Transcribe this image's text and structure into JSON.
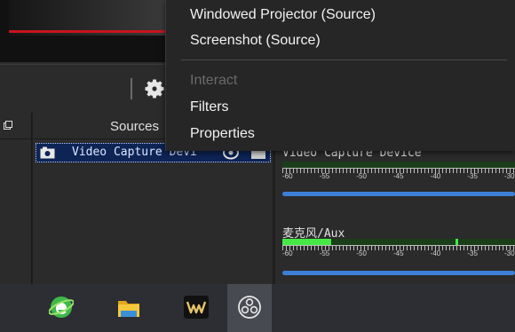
{
  "context_menu": {
    "items": [
      {
        "label": "Windowed Projector (Source)",
        "enabled": true
      },
      {
        "label": "Screenshot (Source)",
        "enabled": true
      },
      {
        "label": "Interact",
        "enabled": false
      },
      {
        "label": "Filters",
        "enabled": true
      },
      {
        "label": "Properties",
        "enabled": true
      }
    ]
  },
  "sources": {
    "header": "Sources",
    "items": [
      {
        "label": "Video Capture Devi",
        "icon": "camera-icon"
      }
    ]
  },
  "mixer": {
    "channels": [
      {
        "name": "Video Capture Device",
        "level": 0.0,
        "volume": 1.0,
        "scale": [
          "-60",
          "-55",
          "-50",
          "-45",
          "-40",
          "-35",
          "-30"
        ]
      },
      {
        "name": "麦克风/Aux",
        "level": 0.21,
        "volume": 1.0,
        "scale": [
          "-60",
          "-55",
          "-50",
          "-45",
          "-40",
          "-35",
          "-30"
        ]
      }
    ]
  },
  "taskbar": {
    "apps": [
      {
        "icon": "internet-explorer-icon",
        "active": false
      },
      {
        "icon": "file-explorer-icon",
        "active": false
      },
      {
        "icon": "wps-office-icon",
        "active": false
      },
      {
        "icon": "obs-studio-icon",
        "active": true
      }
    ]
  },
  "colors": {
    "menu_bg": "#262626",
    "selection": "#0d2455",
    "meter_green": "#46e846",
    "volume_blue": "#3d7fd6",
    "taskbar_bg": "#2d2e34"
  }
}
